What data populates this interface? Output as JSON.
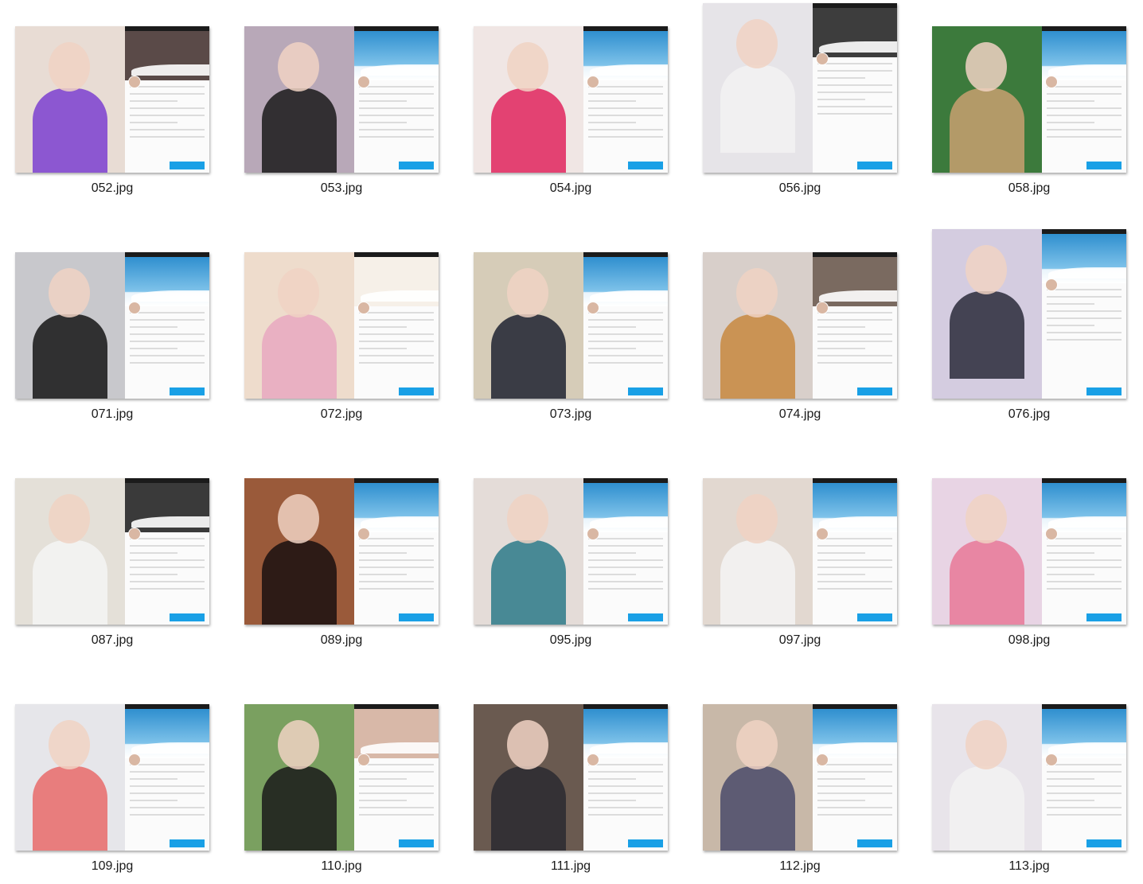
{
  "files": [
    {
      "name": "052.jpg",
      "photo": "#e8dcd4",
      "body": "#7b3fd0",
      "banner": "#5a4a48"
    },
    {
      "name": "053.jpg",
      "photo": "#b8a8b8",
      "body": "#1a1a1a",
      "banner": "#4aa3de"
    },
    {
      "name": "054.jpg",
      "photo": "#f0e6e4",
      "body": "#e0245e",
      "banner": "#4aa3de"
    },
    {
      "name": "056.jpg",
      "photo": "#e6e4e8",
      "body": "#f2f2f2",
      "banner": "#3d3d3d"
    },
    {
      "name": "058.jpg",
      "photo": "#3c7a3c",
      "body": "#c8a070",
      "banner": "#4aa3de"
    },
    {
      "name": "071.jpg",
      "photo": "#c8c8cc",
      "body": "#151515",
      "banner": "#4aa3de"
    },
    {
      "name": "072.jpg",
      "photo": "#eedccc",
      "body": "#e8a8c0",
      "banner": "#f6f0e8"
    },
    {
      "name": "073.jpg",
      "photo": "#d6ccb8",
      "body": "#1e2230",
      "banner": "#4aa3de"
    },
    {
      "name": "074.jpg",
      "photo": "#d8cfca",
      "body": "#c88840",
      "banner": "#7a6a60"
    },
    {
      "name": "076.jpg",
      "photo": "#d4cce0",
      "body": "#2a2a3a",
      "banner": "#4aa3de"
    },
    {
      "name": "087.jpg",
      "photo": "#e4e0d8",
      "body": "#f4f4f4",
      "banner": "#3a3a3a"
    },
    {
      "name": "089.jpg",
      "photo": "#9a5a3a",
      "body": "#1a1010",
      "banner": "#4aa3de"
    },
    {
      "name": "095.jpg",
      "photo": "#e4dcd8",
      "body": "#2d7a8a",
      "banner": "#4aa3de"
    },
    {
      "name": "097.jpg",
      "photo": "#e2d8d0",
      "body": "#f4f4f4",
      "banner": "#4aa3de"
    },
    {
      "name": "098.jpg",
      "photo": "#e8d4e4",
      "body": "#e87898",
      "banner": "#4aa3de"
    },
    {
      "name": "109.jpg",
      "photo": "#e6e6ea",
      "body": "#e86a6a",
      "banner": "#4aa3de"
    },
    {
      "name": "110.jpg",
      "photo": "#7aa060",
      "body": "#1a1a1a",
      "banner": "#d8b8a8"
    },
    {
      "name": "111.jpg",
      "photo": "#6a5a50",
      "body": "#2a2a30",
      "banner": "#4aa3de"
    },
    {
      "name": "112.jpg",
      "photo": "#c8b8a8",
      "body": "#4a4a6a",
      "banner": "#4aa3de"
    },
    {
      "name": "113.jpg",
      "photo": "#e8e4ea",
      "body": "#f2f2f2",
      "banner": "#4aa3de"
    }
  ]
}
